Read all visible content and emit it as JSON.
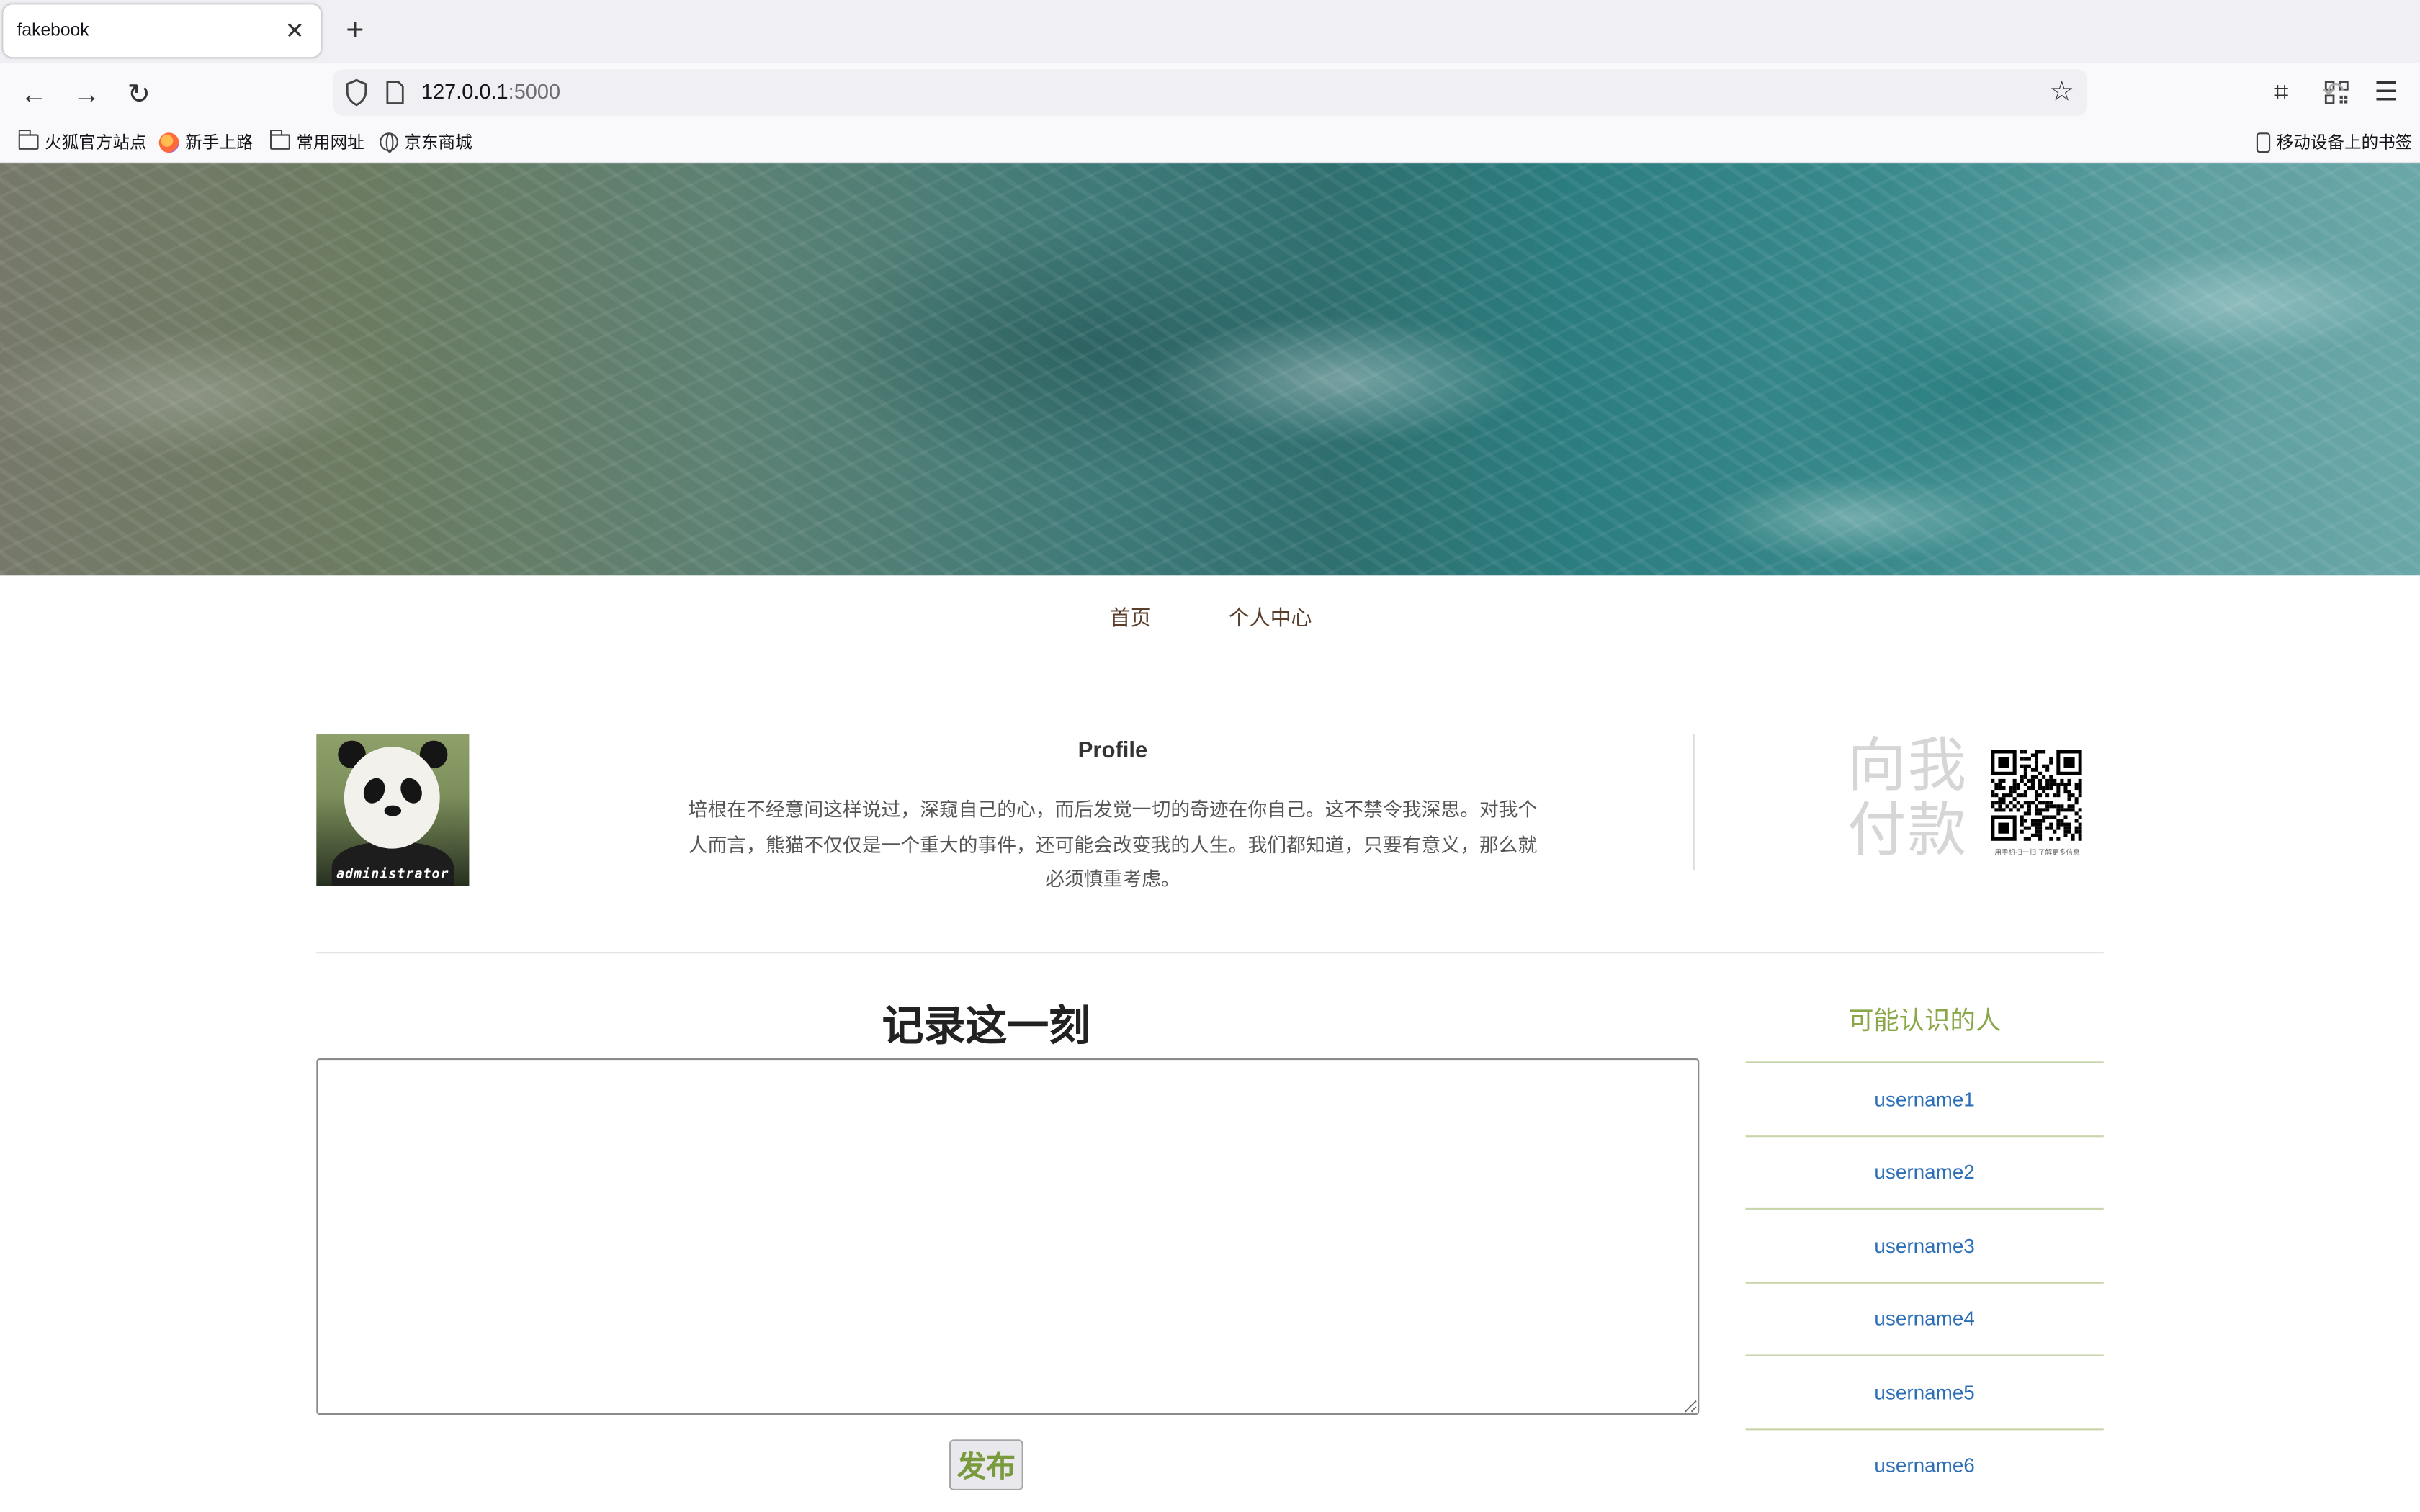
{
  "browser": {
    "tab_title": "fakebook",
    "url_host": "127.0.0.1",
    "url_port": ":5000",
    "bookmarks": [
      "火狐官方站点",
      "新手上路",
      "常用网址",
      "京东商城"
    ],
    "mobile_bookmarks": "移动设备上的书签"
  },
  "nav": {
    "home": "首页",
    "profile_center": "个人中心"
  },
  "profile": {
    "avatar_caption": "administrator",
    "title": "Profile",
    "bio": "培根在不经意间这样说过，深窥自己的心，而后发觉一切的奇迹在你自己。这不禁令我深思。对我个人而言，熊猫不仅仅是一个重大的事件，还可能会改变我的人生。我们都知道，只要有意义，那么就必须慎重考虑。",
    "pay_text_line1": "向我",
    "pay_text_line2": "付款",
    "qr_caption": "用手机扫一扫 了解更多信息"
  },
  "post": {
    "heading": "记录这一刻",
    "textarea_value": "",
    "publish_label": "发布"
  },
  "people": {
    "heading": "可能认识的人",
    "items": [
      "username1",
      "username2",
      "username3",
      "username4",
      "username5",
      "username6"
    ]
  }
}
